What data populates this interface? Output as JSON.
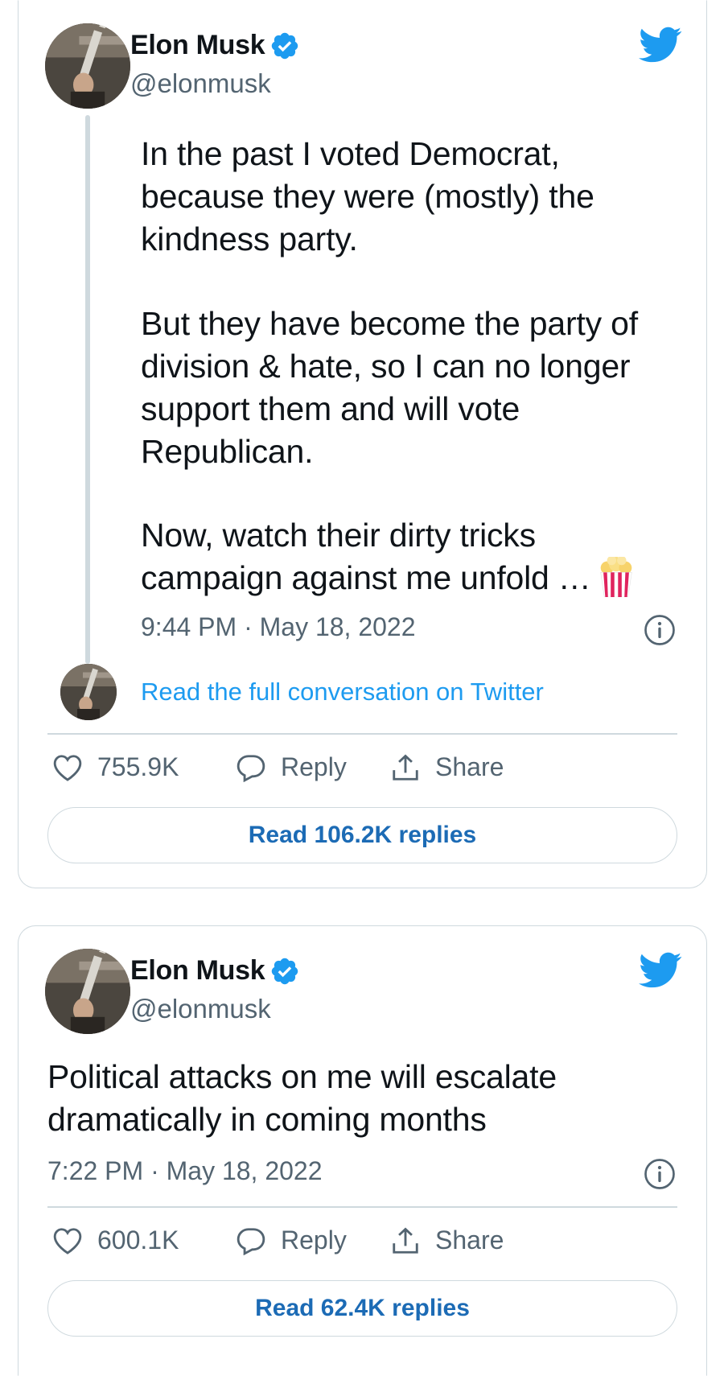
{
  "tweets": [
    {
      "author": {
        "name": "Elon Musk",
        "handle": "@elonmusk"
      },
      "paragraphs": [
        "In the past I voted Democrat,\nbecause they were (mostly) the\nkindness party.",
        "But they have become the party of\ndivision & hate, so I can no longer\nsupport them and will vote\nRepublican.",
        "Now, watch their dirty tricks\ncampaign against me unfold …"
      ],
      "emoji_icon": "popcorn-icon",
      "timestamp": "9:44 PM · May 18, 2022",
      "read_conversation": "Read the full conversation on Twitter",
      "likes": "755.9K",
      "reply_label": "Reply",
      "share_label": "Share",
      "read_replies": "Read 106.2K replies"
    },
    {
      "author": {
        "name": "Elon Musk",
        "handle": "@elonmusk"
      },
      "text": "Political attacks on me will escalate\ndramatically in coming months",
      "timestamp": "7:22 PM · May 18, 2022",
      "likes": "600.1K",
      "reply_label": "Reply",
      "share_label": "Share",
      "read_replies": "Read 62.4K replies"
    }
  ],
  "colors": {
    "accent": "#1d9bf0",
    "replies_link": "#1c6bb5",
    "muted": "#536471",
    "border": "#cfd9de",
    "text": "#0f1419"
  }
}
